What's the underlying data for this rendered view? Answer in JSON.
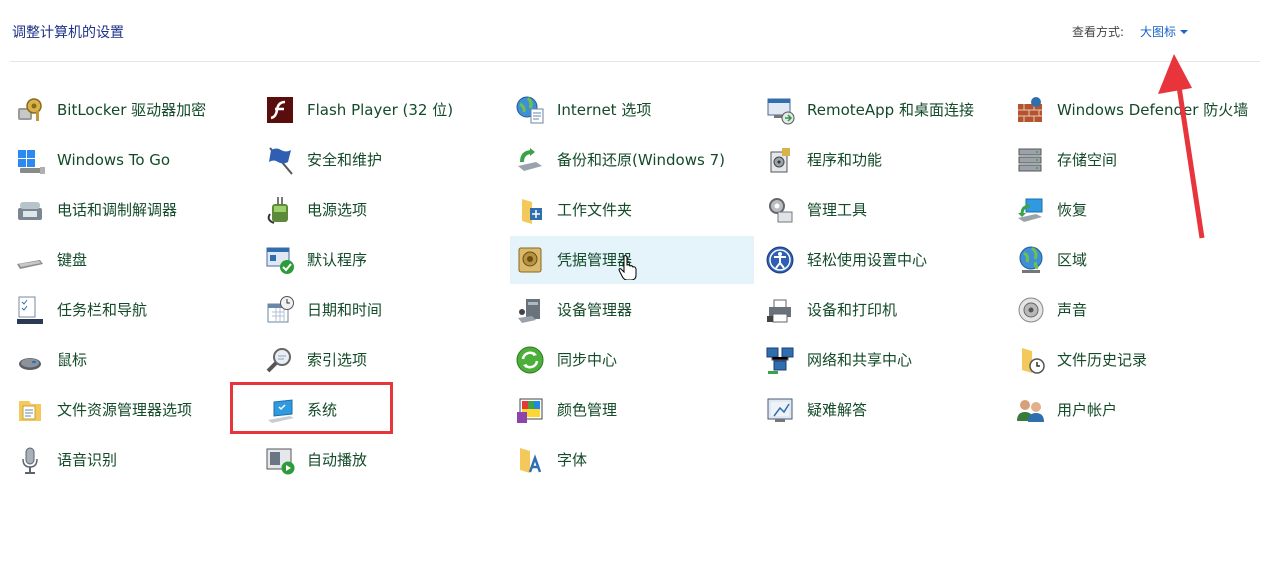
{
  "header": {
    "title": "调整计算机的设置",
    "view_by_label": "查看方式:",
    "view_by_value": "大图标"
  },
  "items": [
    {
      "label": "BitLocker 驱动器加密",
      "icon": "bitlocker-icon"
    },
    {
      "label": "Flash Player (32 位)",
      "icon": "flash-player-icon"
    },
    {
      "label": "Internet 选项",
      "icon": "internet-options-icon"
    },
    {
      "label": "RemoteApp 和桌面连接",
      "icon": "remoteapp-icon"
    },
    {
      "label": "Windows Defender 防火墙",
      "icon": "firewall-icon"
    },
    {
      "label": "Windows To Go",
      "icon": "windows-to-go-icon"
    },
    {
      "label": "安全和维护",
      "icon": "security-flag-icon"
    },
    {
      "label": "备份和还原(Windows 7)",
      "icon": "backup-restore-icon"
    },
    {
      "label": "程序和功能",
      "icon": "programs-icon"
    },
    {
      "label": "存储空间",
      "icon": "storage-spaces-icon"
    },
    {
      "label": "电话和调制解调器",
      "icon": "phone-modem-icon"
    },
    {
      "label": "电源选项",
      "icon": "power-options-icon"
    },
    {
      "label": "工作文件夹",
      "icon": "work-folders-icon"
    },
    {
      "label": "管理工具",
      "icon": "admin-tools-icon"
    },
    {
      "label": "恢复",
      "icon": "recovery-icon"
    },
    {
      "label": "键盘",
      "icon": "keyboard-icon"
    },
    {
      "label": "默认程序",
      "icon": "default-programs-icon"
    },
    {
      "label": "凭据管理器",
      "icon": "credential-manager-icon"
    },
    {
      "label": "轻松使用设置中心",
      "icon": "ease-of-access-icon"
    },
    {
      "label": "区域",
      "icon": "region-globe-icon"
    },
    {
      "label": "任务栏和导航",
      "icon": "taskbar-icon"
    },
    {
      "label": "日期和时间",
      "icon": "date-time-icon"
    },
    {
      "label": "设备管理器",
      "icon": "device-manager-icon"
    },
    {
      "label": "设备和打印机",
      "icon": "printer-icon"
    },
    {
      "label": "声音",
      "icon": "sound-icon"
    },
    {
      "label": "鼠标",
      "icon": "mouse-icon"
    },
    {
      "label": "索引选项",
      "icon": "indexing-icon"
    },
    {
      "label": "同步中心",
      "icon": "sync-center-icon"
    },
    {
      "label": "网络和共享中心",
      "icon": "network-sharing-icon"
    },
    {
      "label": "文件历史记录",
      "icon": "file-history-icon"
    },
    {
      "label": "文件资源管理器选项",
      "icon": "explorer-options-icon"
    },
    {
      "label": "系统",
      "icon": "system-icon"
    },
    {
      "label": "颜色管理",
      "icon": "color-management-icon"
    },
    {
      "label": "疑难解答",
      "icon": "troubleshooting-icon"
    },
    {
      "label": "用户帐户",
      "icon": "user-accounts-icon"
    },
    {
      "label": "语音识别",
      "icon": "speech-microphone-icon"
    },
    {
      "label": "自动播放",
      "icon": "autoplay-icon"
    },
    {
      "label": "字体",
      "icon": "fonts-icon"
    }
  ]
}
